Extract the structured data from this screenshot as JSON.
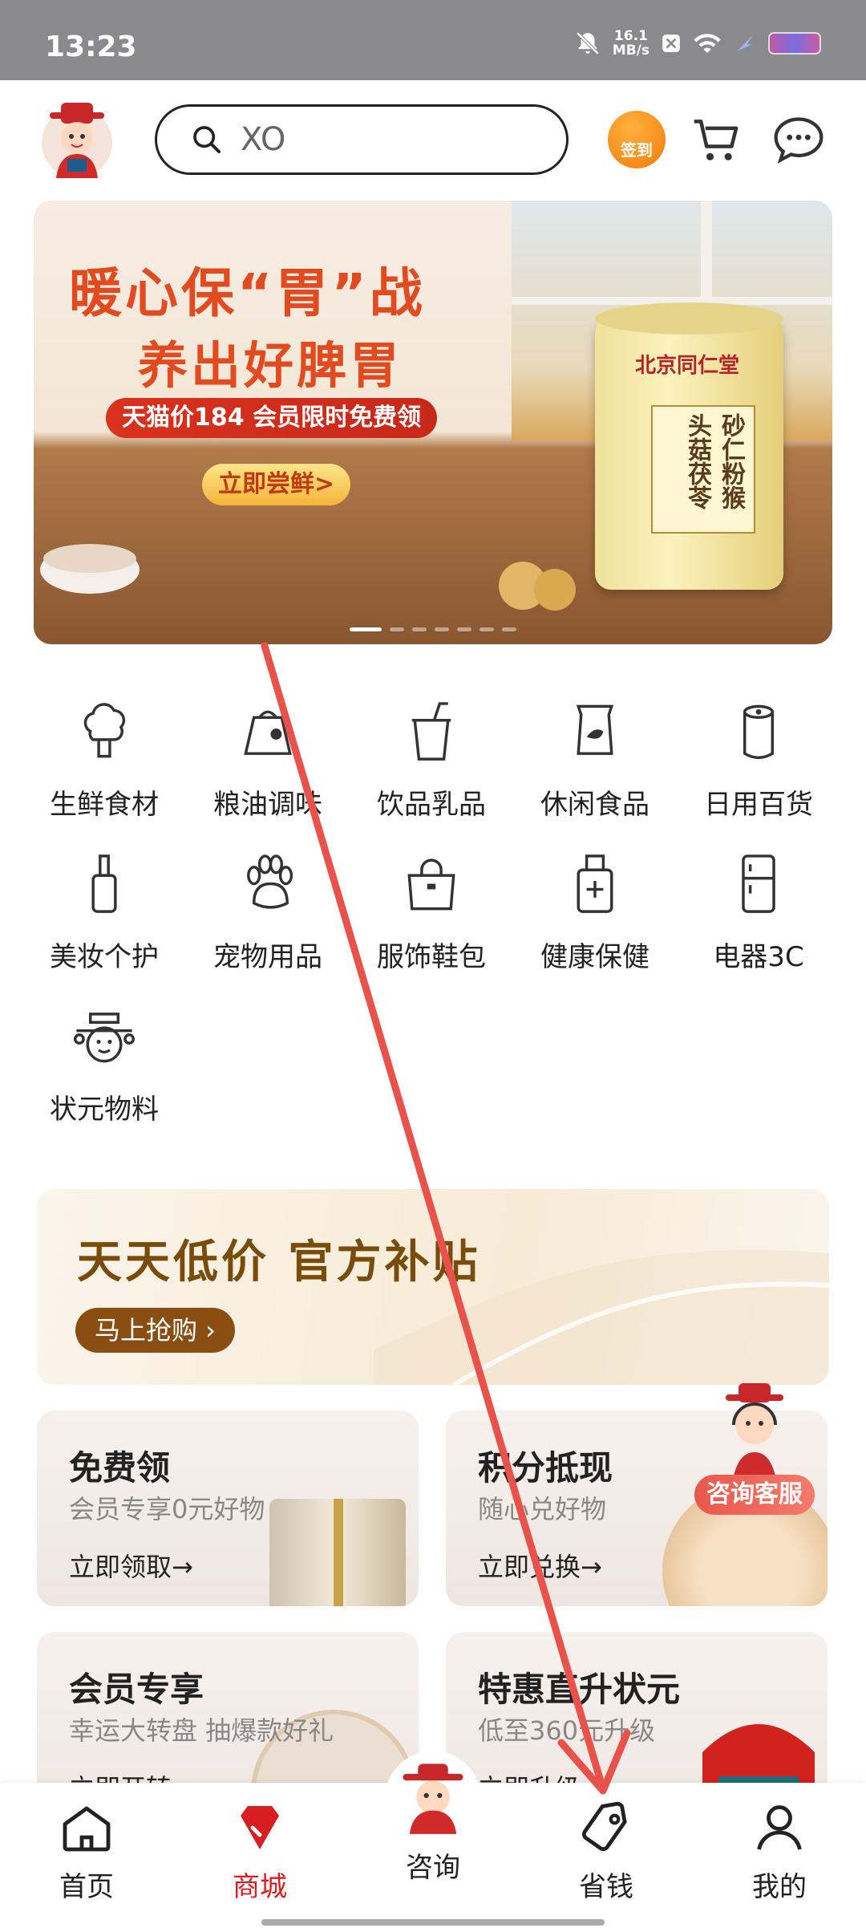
{
  "status_bar": {
    "time": "13:23",
    "net_speed_value": "16.1",
    "net_speed_unit": "MB/s"
  },
  "header": {
    "search": {
      "value": "XO"
    },
    "checkin_label": "签到"
  },
  "banner": {
    "title_line1": "暖心保“胃”战",
    "title_line2": "养出好脾胃",
    "promo": "天猫价184 会员限时免费领",
    "cta": "立即尝鲜>",
    "product_brand": "北京同仁堂",
    "product_name": "砂仁粉猴头菇茯苓"
  },
  "categories": [
    {
      "label": "生鲜食材",
      "icon": "broccoli-icon"
    },
    {
      "label": "粮油调味",
      "icon": "rice-sack-icon"
    },
    {
      "label": "饮品乳品",
      "icon": "drink-cup-icon"
    },
    {
      "label": "休闲食品",
      "icon": "snack-bag-icon"
    },
    {
      "label": "日用百货",
      "icon": "paper-roll-icon"
    },
    {
      "label": "美妆个护",
      "icon": "cosmetic-bottle-icon"
    },
    {
      "label": "宠物用品",
      "icon": "paw-icon"
    },
    {
      "label": "服饰鞋包",
      "icon": "handbag-icon"
    },
    {
      "label": "健康保健",
      "icon": "medicine-bottle-icon"
    },
    {
      "label": "电器3C",
      "icon": "fridge-icon"
    },
    {
      "label": "状元物料",
      "icon": "mascot-face-icon"
    }
  ],
  "lowprice": {
    "title": "天天低价 官方补贴",
    "cta": "马上抢购 ›"
  },
  "cards": [
    {
      "title": "免费领",
      "sub": "会员专享0元好物",
      "link": "立即领取→"
    },
    {
      "title": "积分抵现",
      "sub": "随心兑好物",
      "link": "立即兑换→"
    },
    {
      "title": "会员专享",
      "sub": "幸运大转盘 抽爆款好礼",
      "link": "立即开转"
    },
    {
      "title": "特惠直升状元",
      "sub": "低至360元升级",
      "link": "立即升级"
    }
  ],
  "service_label": "咨询客服",
  "bottom_nav": [
    {
      "label": "首页",
      "icon": "home-icon"
    },
    {
      "label": "商城",
      "icon": "diamond-icon"
    },
    {
      "label": "咨询",
      "icon": "mascot-avatar-icon"
    },
    {
      "label": "省钱",
      "icon": "price-tag-icon"
    },
    {
      "label": "我的",
      "icon": "user-icon"
    }
  ],
  "colors": {
    "accent": "#d81e20",
    "banner_title": "#e24b1f",
    "lowprice_title": "#7a4c0c",
    "annotation": "#e8524a"
  }
}
